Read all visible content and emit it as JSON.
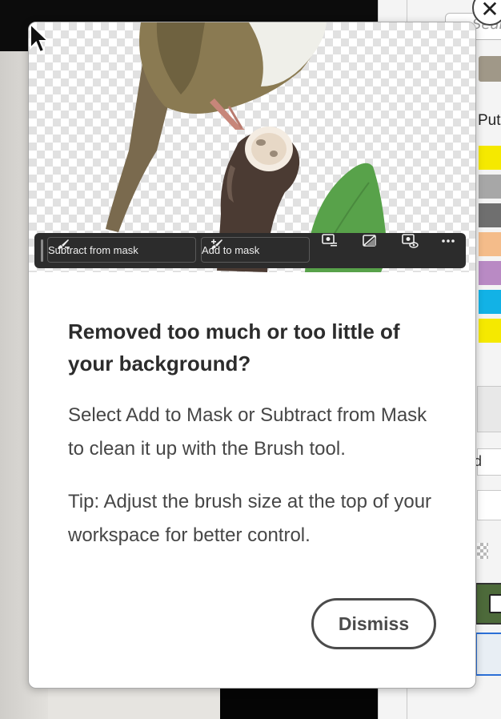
{
  "background": {
    "search_placeholder": "Searc",
    "panel_label": "Put",
    "field_value": "d",
    "swatch_colors": [
      "#f5e900",
      "#a7a7a7",
      "#6f6f6f",
      "#f4bc8a",
      "#b98ac4",
      "#12b2e6",
      "#f5e900"
    ]
  },
  "mask_toolbar": {
    "subtract_label": "Subtract from mask",
    "add_label": "Add to mask",
    "icons": [
      "refine-mask-icon",
      "invert-mask-icon",
      "view-mask-icon",
      "more-icon"
    ]
  },
  "coachmark": {
    "title": "Removed too much or too little of your background?",
    "body1": "Select Add to Mask or Subtract from Mask to clean it up with the Brush tool.",
    "body2": "Tip: Adjust the brush size at the top of your workspace for better control.",
    "dismiss_label": "Dismiss"
  }
}
